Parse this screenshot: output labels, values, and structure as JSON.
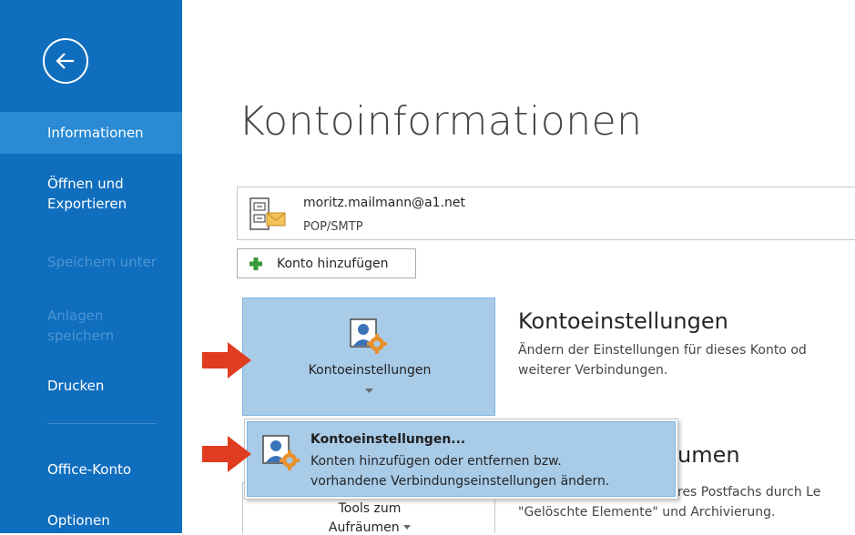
{
  "sidebar": {
    "items": [
      {
        "label": "Informationen"
      },
      {
        "label_line1": "Öffnen und",
        "label_line2": "Exportieren"
      },
      {
        "label": "Speichern unter"
      },
      {
        "label_line1": "Anlagen",
        "label_line2": "speichern"
      },
      {
        "label": "Drucken"
      },
      {
        "label": "Office-Konto"
      },
      {
        "label": "Optionen"
      }
    ],
    "colors": {
      "background": "#106ebe",
      "selected": "#2a8ad4",
      "disabled_text": "#4a95d3"
    }
  },
  "main": {
    "title": "Kontoinformationen",
    "account": {
      "email": "moritz.mailmann@a1.net",
      "type": "POP/SMTP"
    },
    "add_account_label": "Konto hinzufügen",
    "account_settings_button_label": "Kontoeinstellungen",
    "account_settings_section": {
      "heading": "Kontoeinstellungen",
      "line1": "Ändern der Einstellungen für dieses Konto od",
      "line2": "weiterer Verbindungen."
    },
    "cleanup_section": {
      "heading_visible": "umen",
      "line1_visible": "res Postfachs durch Le",
      "line2_visible": "\"Gelöschte Elemente\" und Archivierung."
    },
    "tools_button": {
      "line1": "Tools zum",
      "line2": "Aufräumen"
    }
  },
  "dropdown": {
    "item_title": "Kontoeinstellungen...",
    "item_line1": "Konten hinzufügen oder entfernen bzw.",
    "item_line2": "vorhandene Verbindungseinstellungen ändern."
  },
  "icons": [
    "back-arrow-icon",
    "mailbox-icon",
    "plus-icon",
    "account-settings-icon",
    "chevron-down-icon",
    "red-arrow-icon"
  ],
  "accent_colors": {
    "highlight": "#a8cbe8",
    "plus": "#3a9a3a",
    "arrow": "#e03c1f"
  }
}
